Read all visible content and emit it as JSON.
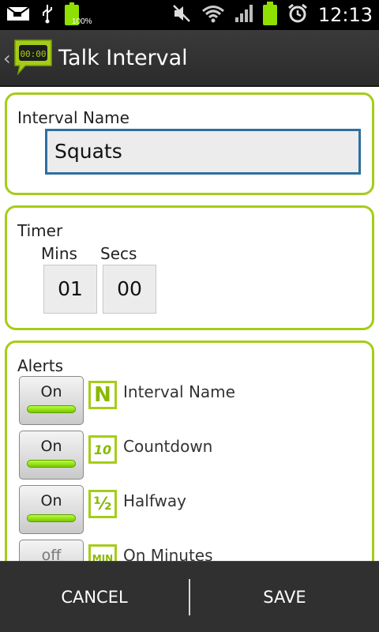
{
  "status_bar": {
    "time": "12:13",
    "battery_percent_label": "100%",
    "icons": [
      "mail-icon",
      "usb-icon",
      "battery-small-icon",
      "mute-icon",
      "wifi-icon",
      "signal-icon",
      "battery-icon",
      "alarm-icon"
    ]
  },
  "title_bar": {
    "title": "Talk Interval",
    "app_icon_text": "00:00"
  },
  "interval_name": {
    "label": "Interval Name",
    "value": "Squats"
  },
  "timer": {
    "label": "Timer",
    "mins_label": "Mins",
    "secs_label": "Secs",
    "mins_value": "01",
    "secs_value": "00"
  },
  "alerts": {
    "label": "Alerts",
    "items": [
      {
        "toggle": "On",
        "icon_text": "N",
        "label": "Interval Name",
        "enabled": true
      },
      {
        "toggle": "On",
        "icon_text": "10",
        "label": "Countdown",
        "enabled": true
      },
      {
        "toggle": "On",
        "icon_text": "½",
        "label": "Halfway",
        "enabled": true
      },
      {
        "toggle": "off",
        "icon_text": "MIN",
        "label": "On Minutes",
        "enabled": false
      }
    ]
  },
  "bottom_bar": {
    "cancel": "CANCEL",
    "save": "SAVE"
  },
  "colors": {
    "accent_green": "#a6cc1a",
    "input_border_blue": "#2e6f9e",
    "toggle_on": "#79c800"
  }
}
